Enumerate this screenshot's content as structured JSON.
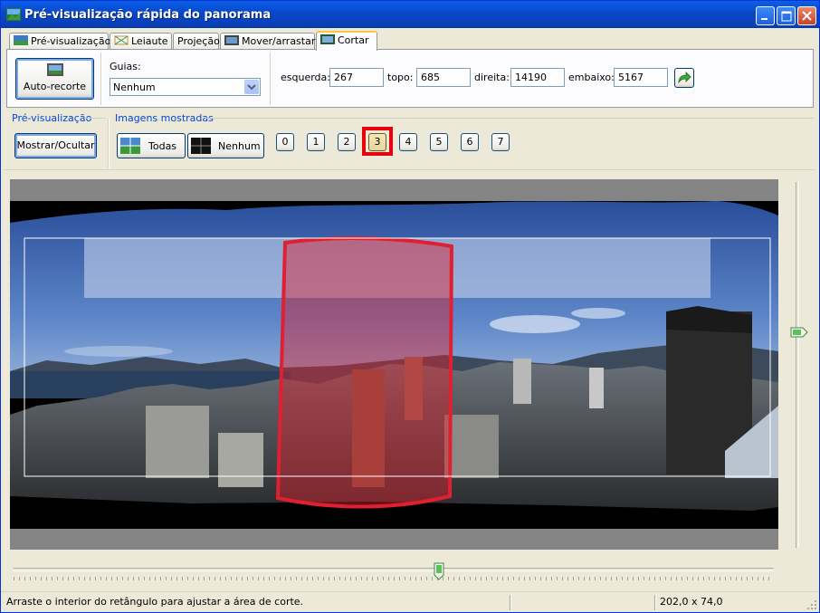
{
  "window": {
    "title": "Pré-visualização rápida do panorama"
  },
  "tabs": [
    {
      "label": "Pré-visualização",
      "icon": "preview-icon"
    },
    {
      "label": "Leiaute",
      "icon": "layout-icon"
    },
    {
      "label": "Projeção"
    },
    {
      "label": "Mover/arrastar",
      "icon": "move-icon"
    },
    {
      "label": "Cortar",
      "icon": "crop-icon",
      "active": true
    }
  ],
  "crop": {
    "auto_crop_label": "Auto-recorte",
    "guides_label": "Guias:",
    "guides_value": "Nenhum",
    "left_label": "esquerda:",
    "left_value": "267",
    "top_label": "topo:",
    "top_value": "685",
    "right_label": "direita:",
    "right_value": "14190",
    "bottom_label": "embaixo:",
    "bottom_value": "5167"
  },
  "preview_group": {
    "title": "Pré-visualização",
    "toggle_label": "Mostrar/Ocultar"
  },
  "images_group": {
    "title": "Imagens mostradas",
    "all_label": "Todas",
    "none_label": "Nenhum",
    "numbers": [
      "0",
      "1",
      "2",
      "3",
      "4",
      "5",
      "6",
      "7"
    ],
    "selected": "3"
  },
  "status": {
    "message": "Arraste o interior do retângulo para ajustar a área de corte.",
    "fov": "202,0 x 74,0"
  },
  "colors": {
    "highlight": "#e8000d",
    "accent": "#0046d5",
    "titlebar": "#0a5fe8"
  }
}
